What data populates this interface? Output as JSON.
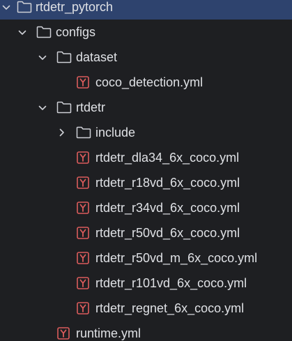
{
  "project_tree": {
    "root": {
      "label": "rtdetr_pytorch",
      "icon": "folder-icon",
      "expanded": true,
      "selected": true
    },
    "configs": {
      "label": "configs",
      "icon": "folder-icon",
      "expanded": true
    },
    "dataset": {
      "label": "dataset",
      "icon": "folder-icon",
      "expanded": true
    },
    "coco_detection": {
      "label": "coco_detection.yml",
      "icon": "yaml-file-icon"
    },
    "rtdetr": {
      "label": "rtdetr",
      "icon": "folder-icon",
      "expanded": true
    },
    "include": {
      "label": "include",
      "icon": "folder-icon",
      "expanded": false
    },
    "files": [
      {
        "label": "rtdetr_dla34_6x_coco.yml",
        "icon": "yaml-file-icon"
      },
      {
        "label": "rtdetr_r18vd_6x_coco.yml",
        "icon": "yaml-file-icon"
      },
      {
        "label": "rtdetr_r34vd_6x_coco.yml",
        "icon": "yaml-file-icon"
      },
      {
        "label": "rtdetr_r50vd_6x_coco.yml",
        "icon": "yaml-file-icon"
      },
      {
        "label": "rtdetr_r50vd_m_6x_coco.yml",
        "icon": "yaml-file-icon"
      },
      {
        "label": "rtdetr_r101vd_6x_coco.yml",
        "icon": "yaml-file-icon"
      },
      {
        "label": "rtdetr_regnet_6x_coco.yml",
        "icon": "yaml-file-icon"
      }
    ],
    "runtime": {
      "label": "runtime.yml",
      "icon": "yaml-file-icon"
    }
  },
  "colors": {
    "background": "#1e1f22",
    "selection": "#2e436e",
    "text": "#dfe1e5",
    "icon_gray": "#ced0d6",
    "yaml_red": "#db5c5c"
  }
}
